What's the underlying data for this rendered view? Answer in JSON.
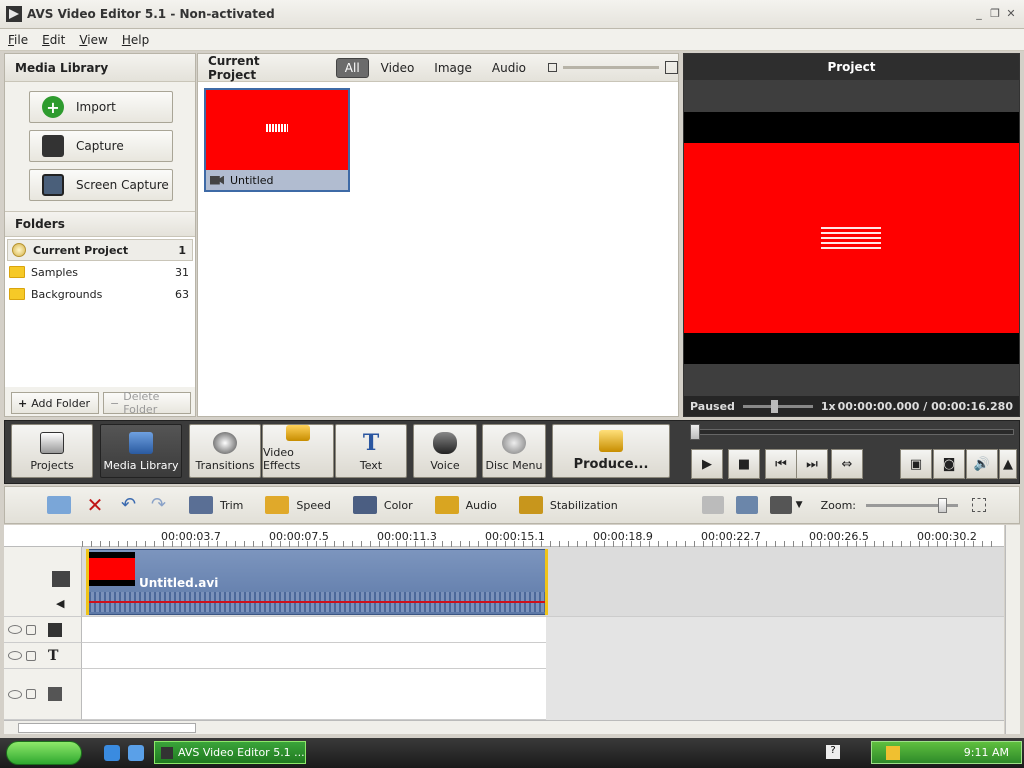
{
  "window": {
    "title": "AVS Video Editor 5.1 - Non-activated"
  },
  "menu": [
    "File",
    "Edit",
    "View",
    "Help"
  ],
  "media_library": {
    "title": "Media Library",
    "buttons": {
      "import": "Import",
      "capture": "Capture",
      "screen_capture": "Screen Capture"
    },
    "folders_title": "Folders",
    "folders": [
      {
        "label": "Current Project",
        "count": "1"
      },
      {
        "label": "Samples",
        "count": "31"
      },
      {
        "label": "Backgrounds",
        "count": "63"
      }
    ],
    "add_folder": "Add Folder",
    "delete_folder": "Delete Folder"
  },
  "current_project": {
    "title": "Current Project",
    "filters": [
      "All",
      "Video",
      "Image",
      "Audio"
    ],
    "active_filter": "All",
    "item_label": "Untitled"
  },
  "preview": {
    "title": "Project",
    "status": "Paused",
    "speed": "1x",
    "time": "00:00:00.000 / 00:00:16.280"
  },
  "main_tools": {
    "projects": "Projects",
    "media_library": "Media Library",
    "transitions": "Transitions",
    "video_effects": "Video Effects",
    "text": "Text",
    "voice": "Voice",
    "disc_menu": "Disc Menu",
    "produce": "Produce..."
  },
  "timeline_tools": {
    "trim": "Trim",
    "speed": "Speed",
    "color": "Color",
    "audio": "Audio",
    "stabilization": "Stabilization",
    "zoom": "Zoom:"
  },
  "ruler": [
    "00:00:03.7",
    "00:00:07.5",
    "00:00:11.3",
    "00:00:15.1",
    "00:00:18.9",
    "00:00:22.7",
    "00:00:26.5",
    "00:00:30.2"
  ],
  "clip": {
    "name": "Untitled.avi"
  },
  "taskbar": {
    "task": "AVS Video Editor 5.1 ...",
    "clock": "9:11 AM"
  }
}
